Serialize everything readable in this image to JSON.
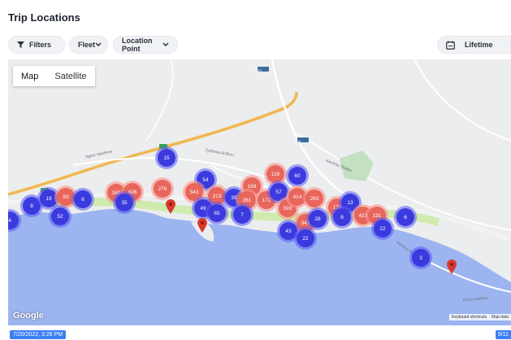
{
  "page": {
    "title": "Trip Locations"
  },
  "toolbar": {
    "filters_label": "Filters",
    "fleet_label": "Fleet",
    "location_point_label": "Location Point",
    "period_label": "Lifetime"
  },
  "map": {
    "type_options": [
      "Map",
      "Satellite"
    ],
    "selected_type": "Map",
    "road_labels": [
      "E321",
      "E306",
      "Agios Vasileios",
      "Kentrou Skalas",
      "Tyrifonia Ardhou",
      "Kentrou Narkou",
      "Kryos Narkos"
    ],
    "clusters": [
      {
        "label": "4",
        "color": "blue"
      },
      {
        "label": "8",
        "color": "blue"
      },
      {
        "label": "19",
        "color": "blue"
      },
      {
        "label": "93",
        "color": "red"
      },
      {
        "label": "6",
        "color": "blue"
      },
      {
        "label": "52",
        "color": "blue"
      },
      {
        "label": "169",
        "color": "red"
      },
      {
        "label": "426",
        "color": "red"
      },
      {
        "label": "35",
        "color": "blue"
      },
      {
        "label": "15",
        "color": "blue"
      },
      {
        "label": "276",
        "color": "red"
      },
      {
        "label": "54",
        "color": "blue"
      },
      {
        "label": "543",
        "color": "red"
      },
      {
        "label": "213",
        "color": "red"
      },
      {
        "label": "49",
        "color": "blue"
      },
      {
        "label": "65",
        "color": "blue"
      },
      {
        "label": "39",
        "color": "blue"
      },
      {
        "label": "169",
        "color": "red"
      },
      {
        "label": "261",
        "color": "red"
      },
      {
        "label": "7",
        "color": "blue"
      },
      {
        "label": "118",
        "color": "red"
      },
      {
        "label": "172",
        "color": "red"
      },
      {
        "label": "60",
        "color": "blue"
      },
      {
        "label": "57",
        "color": "blue"
      },
      {
        "label": "593",
        "color": "red"
      },
      {
        "label": "414",
        "color": "red"
      },
      {
        "label": "263",
        "color": "red"
      },
      {
        "label": "343",
        "color": "red"
      },
      {
        "label": "43",
        "color": "blue"
      },
      {
        "label": "28",
        "color": "blue"
      },
      {
        "label": "22",
        "color": "blue"
      },
      {
        "label": "179",
        "color": "red"
      },
      {
        "label": "13",
        "color": "blue"
      },
      {
        "label": "8",
        "color": "blue"
      },
      {
        "label": "423",
        "color": "red"
      },
      {
        "label": "131",
        "color": "red"
      },
      {
        "label": "22",
        "color": "blue"
      },
      {
        "label": "6",
        "color": "blue"
      },
      {
        "label": "3",
        "color": "blue"
      }
    ],
    "google_logo": "Google",
    "attribution": [
      "Keyboard shortcuts",
      "Map data"
    ]
  },
  "timeline": {
    "start_label": "7/20/2022, 3:26 PM",
    "end_label": "9/11"
  },
  "colors": {
    "cluster_blue": "#3a3adf",
    "cluster_red": "#e8665c",
    "sea": "#9cb4f0",
    "accent": "#3d7ff5"
  }
}
